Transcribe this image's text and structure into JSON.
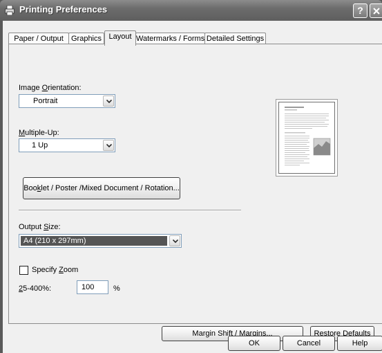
{
  "window": {
    "title": "Printing Preferences",
    "help_button": "?",
    "close_button": "X"
  },
  "tabs": [
    {
      "label": "Paper / Output"
    },
    {
      "label": "Graphics"
    },
    {
      "label": "Layout",
      "active": true
    },
    {
      "label": "Watermarks / Forms"
    },
    {
      "label": "Detailed Settings"
    }
  ],
  "layout": {
    "image_orientation": {
      "label_pre": "Image ",
      "label_accel": "O",
      "label_post": "rientation:",
      "value": "Portrait"
    },
    "multiple_up": {
      "label_accel": "M",
      "label_post": "ultiple-Up:",
      "value": "1 Up"
    },
    "booklet_button": {
      "label_pre": "Boo",
      "label_accel": "k",
      "label_post": "let / Poster /Mixed Document / Rotation..."
    },
    "output_size": {
      "label_pre": "Output ",
      "label_accel": "S",
      "label_post": "ize:",
      "value": "A4 (210 x 297mm)"
    },
    "specify_zoom": {
      "label_pre": "Specify ",
      "label_accel": "Z",
      "label_post": "oom",
      "checked": false
    },
    "zoom_range": {
      "label_accel": "2",
      "label_post": "5-400%:",
      "value": "100",
      "unit": "%"
    },
    "margin_button": "Margin Shift / Margins...",
    "restore_button": {
      "label_pre": "Restore ",
      "label_accel": "D",
      "label_post": "efaults"
    }
  },
  "footer": {
    "ok": "OK",
    "cancel": "Cancel",
    "help": "Help"
  },
  "colors": {
    "titlebar": "#6c6c6c",
    "selected_value_bg": "#555555",
    "face": "#f0f0f0"
  }
}
